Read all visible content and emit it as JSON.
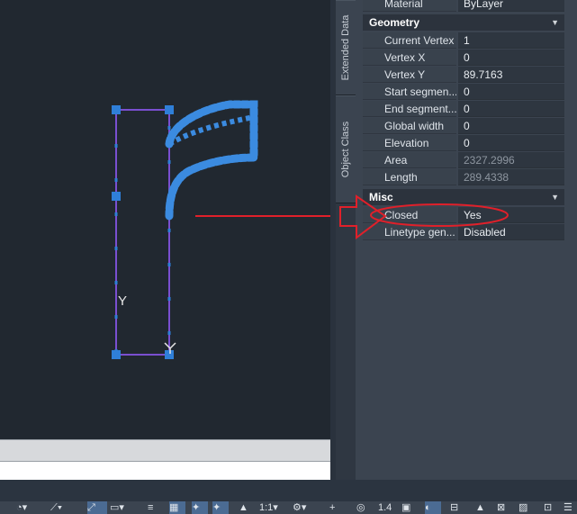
{
  "palette": {
    "tabs": [
      "Extended Data",
      "Object Class"
    ],
    "top_row": {
      "name": "Material",
      "value": "ByLayer"
    },
    "sections": [
      {
        "title": "Geometry",
        "rows": [
          {
            "name": "Current Vertex",
            "value": "1",
            "readonly": false
          },
          {
            "name": "Vertex X",
            "value": "0",
            "readonly": false
          },
          {
            "name": "Vertex Y",
            "value": "89.7163",
            "readonly": false
          },
          {
            "name": "Start segmen...",
            "value": "0",
            "readonly": false
          },
          {
            "name": "End segment...",
            "value": "0",
            "readonly": false
          },
          {
            "name": "Global width",
            "value": "0",
            "readonly": false
          },
          {
            "name": "Elevation",
            "value": "0",
            "readonly": false
          },
          {
            "name": "Area",
            "value": "2327.2996",
            "readonly": true
          },
          {
            "name": "Length",
            "value": "289.4338",
            "readonly": true
          }
        ]
      },
      {
        "title": "Misc",
        "rows": [
          {
            "name": "Closed",
            "value": "Yes",
            "readonly": false
          },
          {
            "name": "Linetype gen...",
            "value": "Disabled",
            "readonly": false
          }
        ]
      }
    ]
  },
  "canvas": {
    "ucs_y_label": "Y",
    "annotation_color": "#e0202a",
    "polyline_color": "#7a4fd0",
    "grip_color": "#2f7fd8"
  },
  "statusbar": {
    "scale": "1:1",
    "annotation_scale": "1.4",
    "icons": [
      "polar-icon",
      "osnap-icon",
      "otrack-icon",
      "lineweight-icon",
      "transparency-icon",
      "selection-cycling-icon",
      "gizmo-icon",
      "annotation-visibility-icon",
      "auto-scale-icon",
      "scale-icon",
      "workspace-gear-icon",
      "plus-icon",
      "annotation-monitor-icon",
      "units-icon",
      "quick-properties-icon",
      "lock-ui-icon",
      "isolate-icon",
      "hardware-accel-icon",
      "clean-screen-icon"
    ]
  }
}
